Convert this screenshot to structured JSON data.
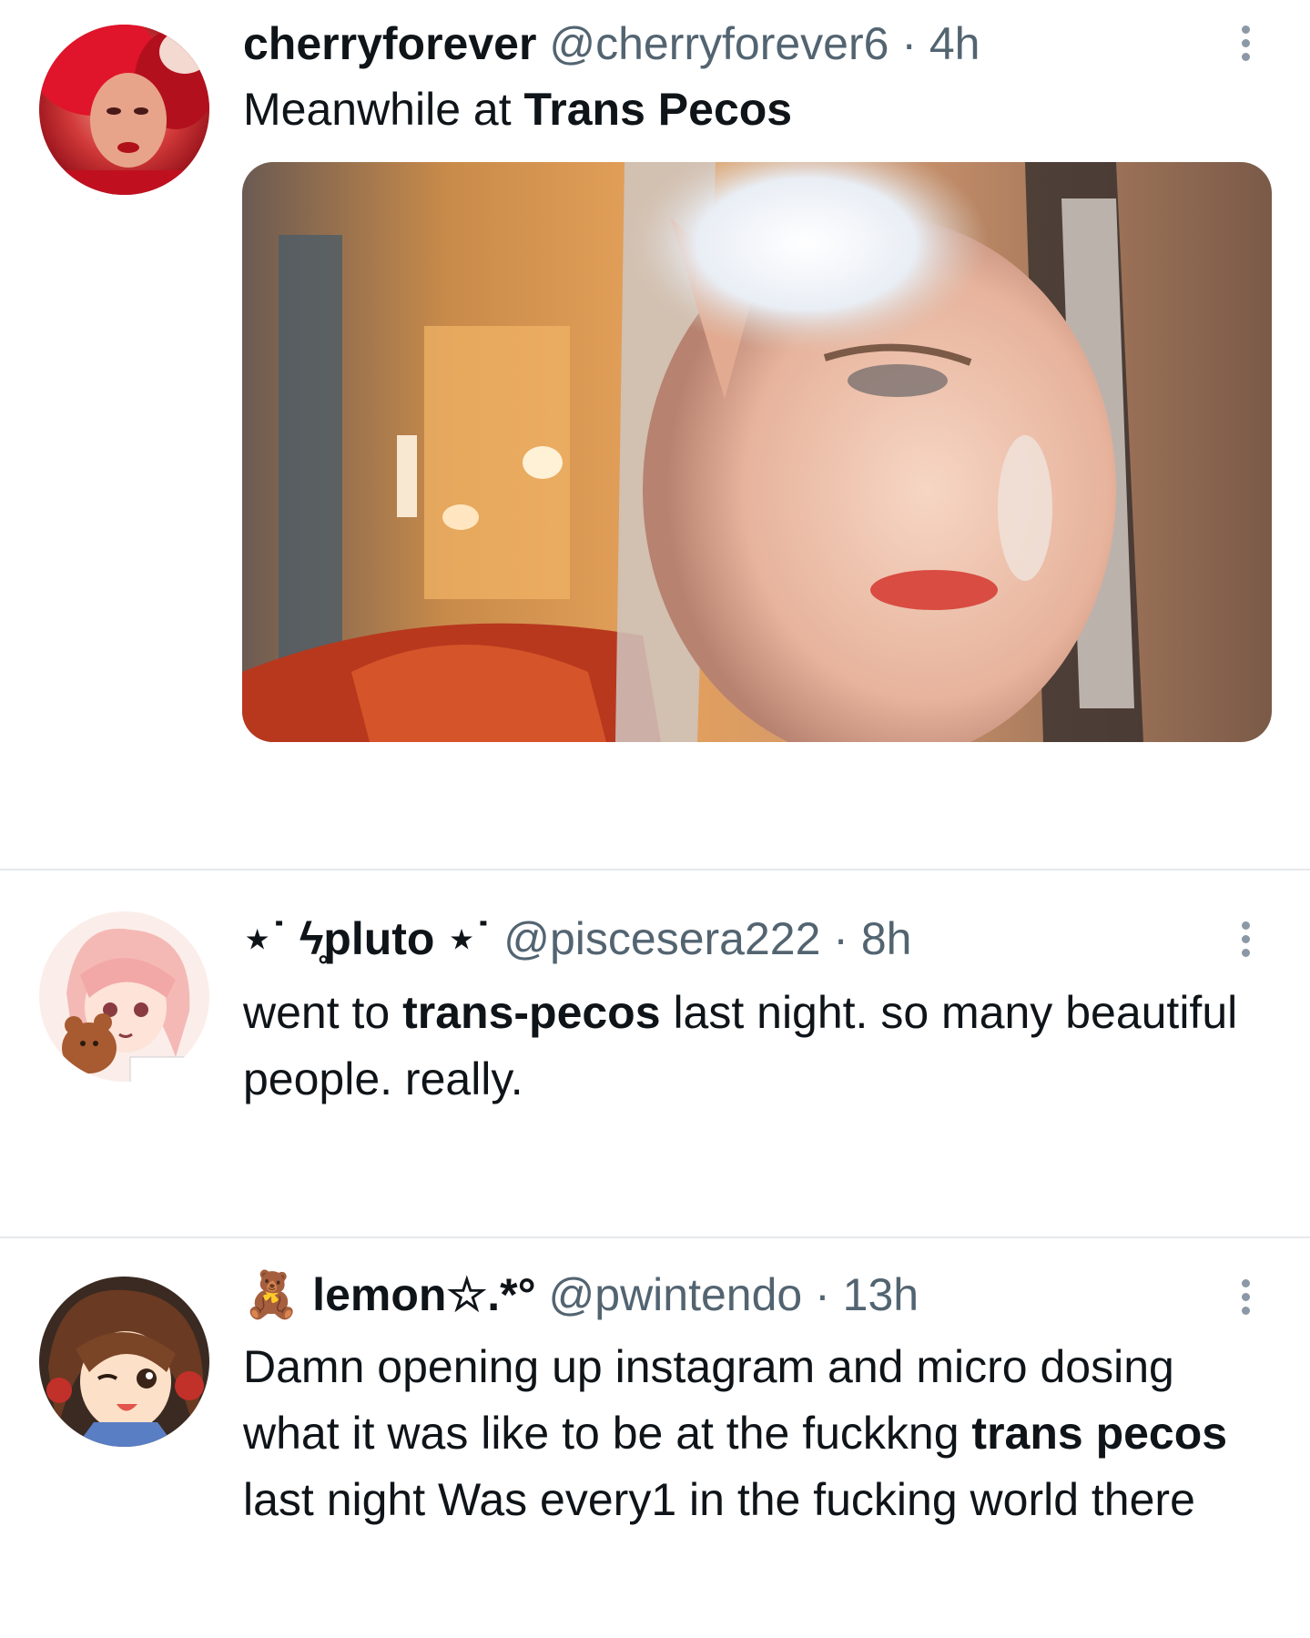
{
  "tweets": [
    {
      "display_name": "cherryforever",
      "handle": "@cherryforever6",
      "separator": " · ",
      "time": "4h",
      "text_pre": "Meanwhile at ",
      "text_bold": "Trans Pecos",
      "text_post": "",
      "avatar_icon": "avatar-photo-red-hair",
      "has_media": true,
      "media_icon": "photo-person-glitter-braids"
    },
    {
      "display_name": "⋆˙ ϟ̥pluto ⋆˙",
      "handle": "@piscesera222",
      "separator": " · ",
      "time": "8h",
      "text_pre": "went to ",
      "text_bold": "trans-pecos",
      "text_post": " last night. so many beautiful people. really.",
      "avatar_icon": "avatar-anime-pink-hair-teddy"
    },
    {
      "display_name_emoji": "🧸",
      "display_name": "lemon☆.*°",
      "handle": "@pwintendo",
      "separator": " · ",
      "time": "13h",
      "text_pre": "Damn opening up instagram and micro dosing what it was like to be at the fuckkng ",
      "text_bold": "trans pecos",
      "text_post": " last night Was every1 in the fucking world there",
      "avatar_icon": "avatar-anime-brown-hair-headphones"
    }
  ],
  "icons": {
    "more": "more-vertical-icon"
  },
  "colors": {
    "text": "#0f1419",
    "secondary": "#536471",
    "divider": "#e6e9ec",
    "more_dots": "#8b98a5"
  }
}
